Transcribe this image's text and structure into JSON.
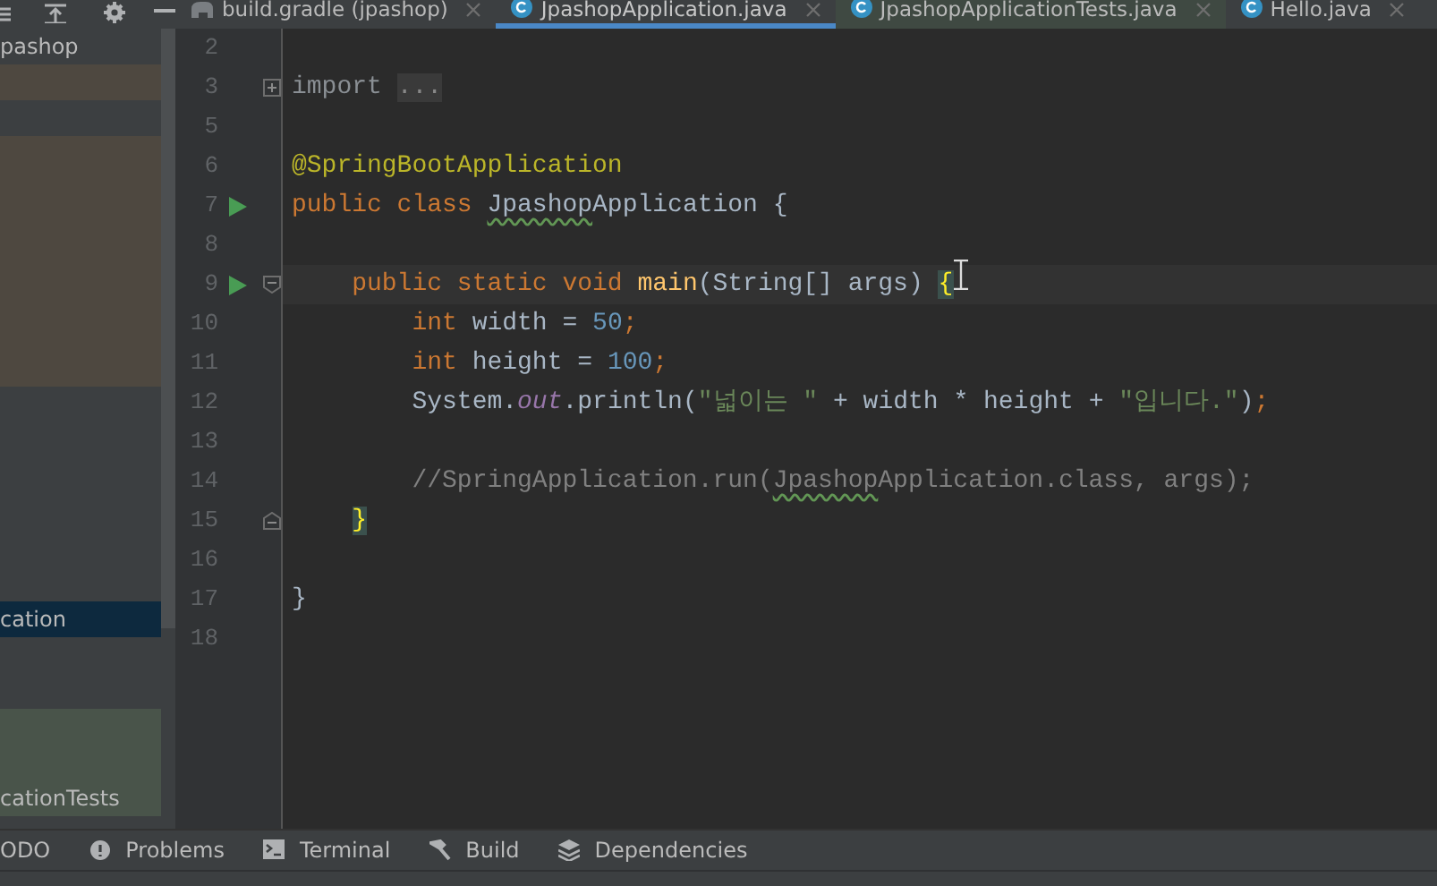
{
  "project_panel": {
    "toolbar": [
      {
        "kind": "partial"
      },
      {
        "kind": "collapse"
      },
      {
        "kind": "gear"
      },
      {
        "kind": "minimize"
      }
    ],
    "rows": [
      {
        "label": "pashop",
        "selected": false
      },
      {
        "color": "#4e4840",
        "selected": false
      },
      {
        "selected": false
      },
      {
        "color": "#4e4840",
        "selected": false
      },
      {
        "color": "#4e4840",
        "selected": false
      },
      {
        "color": "#4e4840",
        "selected": false
      },
      {
        "color": "#4e4840",
        "selected": false
      },
      {
        "color": "#4e4840",
        "selected": false
      },
      {
        "color": "#4e4840",
        "selected": false
      },
      {
        "color": "#4e4840",
        "selected": false
      },
      {
        "selected": false
      },
      {
        "selected": false
      },
      {
        "selected": false
      },
      {
        "selected": false
      },
      {
        "selected": false
      },
      {
        "selected": false
      },
      {
        "label": "cation",
        "selected": true
      },
      {
        "selected": false
      },
      {
        "selected": false
      },
      {
        "color": "#49544a",
        "selected": false
      },
      {
        "color": "#49544a",
        "selected": false
      },
      {
        "color": "#49544a",
        "label": "cationTests",
        "selected": false
      }
    ]
  },
  "tabs": [
    {
      "label": "build.gradle (jpashop)",
      "kind": "gradle",
      "selected": false
    },
    {
      "label": "JpashopApplication.java",
      "kind": "class",
      "selected": true
    },
    {
      "label": "JpashopApplicationTests.java",
      "kind": "class",
      "selected": false,
      "color": "#3f4942"
    },
    {
      "label": "Hello.java",
      "kind": "class",
      "selected": false
    }
  ],
  "editor": {
    "lines": [
      {
        "number": "2"
      },
      {
        "number": "3",
        "fold_start": true,
        "collapsed": true,
        "tokens": [
          {
            "kind": "kw-dim",
            "text": "import "
          },
          {
            "kind": "folded",
            "text": "..."
          }
        ]
      },
      {
        "number": "5"
      },
      {
        "number": "6",
        "tokens": [
          {
            "kind": "annotation",
            "text": "@SpringBootApplication"
          }
        ]
      },
      {
        "number": "7",
        "run": true,
        "tokens": [
          {
            "kind": "keyword",
            "text": "public class "
          },
          {
            "kind": "typo",
            "text": "Jpashop"
          },
          {
            "kind": "plain",
            "text": "Application {"
          }
        ]
      },
      {
        "number": "8"
      },
      {
        "number": "9",
        "run": true,
        "fold_start": true,
        "collapsed": false,
        "current": true,
        "tokens": [
          {
            "kind": "keyword",
            "text": "    public static void "
          },
          {
            "kind": "method",
            "text": "main"
          },
          {
            "kind": "plain",
            "text": "(String[] args) "
          },
          {
            "kind": "brace",
            "text": "{"
          }
        ]
      },
      {
        "number": "10",
        "tokens": [
          {
            "kind": "keyword",
            "text": "        int "
          },
          {
            "kind": "plain",
            "text": "width = "
          },
          {
            "kind": "number",
            "text": "50"
          },
          {
            "kind": "keyword",
            "text": ";"
          }
        ]
      },
      {
        "number": "11",
        "tokens": [
          {
            "kind": "keyword",
            "text": "        int "
          },
          {
            "kind": "plain",
            "text": "height = "
          },
          {
            "kind": "number",
            "text": "100"
          },
          {
            "kind": "keyword",
            "text": ";"
          }
        ]
      },
      {
        "number": "12",
        "tokens": [
          {
            "kind": "plain",
            "text": "        System."
          },
          {
            "kind": "field",
            "text": "out"
          },
          {
            "kind": "plain",
            "text": ".println("
          },
          {
            "kind": "string",
            "text": "\"넓이는 \""
          },
          {
            "kind": "plain",
            "text": " + width * height + "
          },
          {
            "kind": "string",
            "text": "\"입니다.\""
          },
          {
            "kind": "plain",
            "text": ")"
          },
          {
            "kind": "keyword",
            "text": ";"
          }
        ]
      },
      {
        "number": "13"
      },
      {
        "number": "14",
        "tokens": [
          {
            "kind": "comment",
            "text": "        //SpringApplication.run("
          },
          {
            "kind": "comment-typo",
            "text": "Jpashop"
          },
          {
            "kind": "comment",
            "text": "Application.class, args);"
          }
        ]
      },
      {
        "number": "15",
        "fold_end": true,
        "kind": "indented",
        "tokens": [
          {
            "kind": "brace",
            "text": "}"
          }
        ]
      },
      {
        "number": "16"
      },
      {
        "number": "17",
        "tokens": [
          {
            "kind": "plain",
            "text": "}"
          }
        ]
      },
      {
        "number": "18"
      }
    ]
  },
  "tool_windows": [
    {
      "label": "ODO",
      "kind": "none"
    },
    {
      "label": "Problems",
      "kind": "problems"
    },
    {
      "label": "Terminal",
      "kind": "terminal"
    },
    {
      "label": "Build",
      "kind": "build"
    },
    {
      "label": "Dependencies",
      "kind": "dependencies"
    }
  ]
}
